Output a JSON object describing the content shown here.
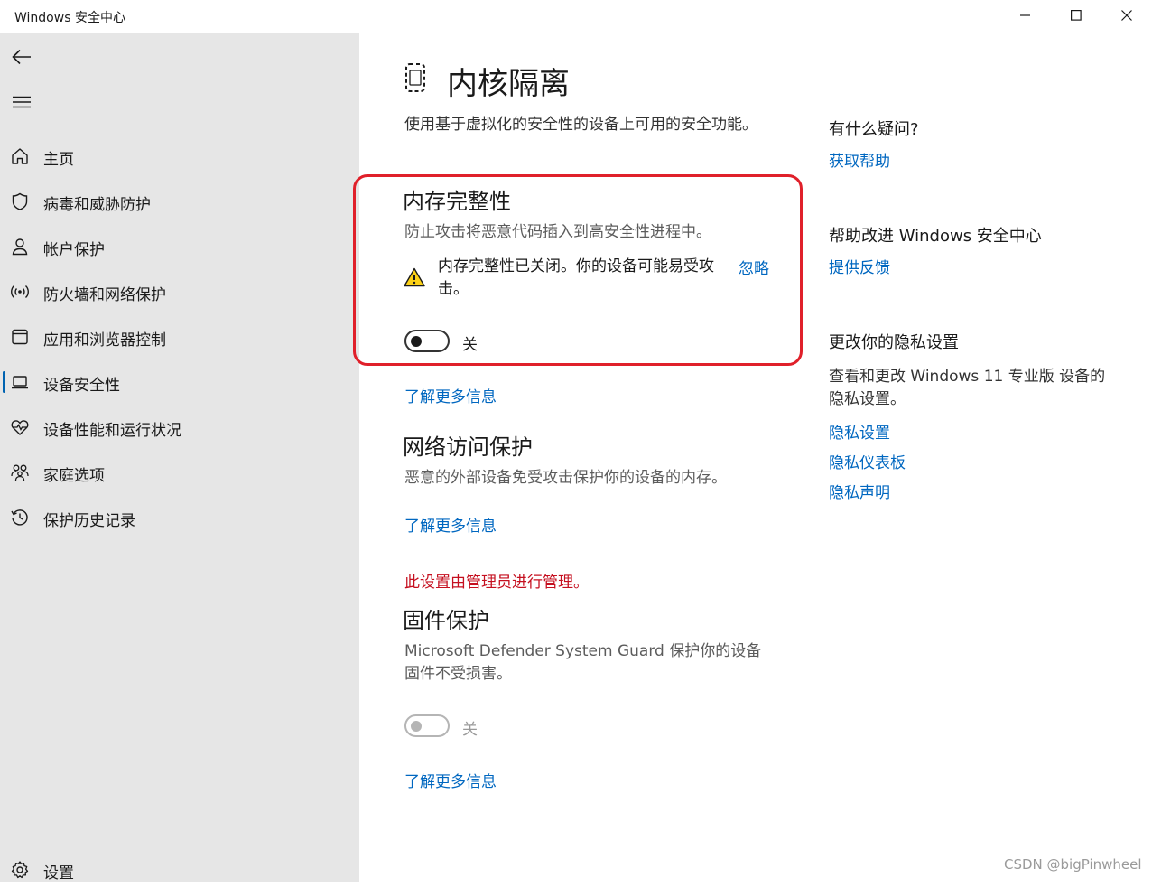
{
  "window": {
    "title": "Windows 安全中心"
  },
  "sidebar": {
    "items": [
      {
        "label": "主页",
        "icon": "home-icon"
      },
      {
        "label": "病毒和威胁防护",
        "icon": "shield-icon"
      },
      {
        "label": "帐户保护",
        "icon": "person-icon"
      },
      {
        "label": "防火墙和网络保护",
        "icon": "wifi-broadcast-icon"
      },
      {
        "label": "应用和浏览器控制",
        "icon": "app-window-icon"
      },
      {
        "label": "设备安全性",
        "icon": "laptop-icon",
        "active": true
      },
      {
        "label": "设备性能和运行状况",
        "icon": "heart-pulse-icon"
      },
      {
        "label": "家庭选项",
        "icon": "family-icon"
      },
      {
        "label": "保护历史记录",
        "icon": "history-icon"
      }
    ],
    "settings_label": "设置"
  },
  "main": {
    "title": "内核隔离",
    "description": "使用基于虚拟化的安全性的设备上可用的安全功能。",
    "memory_integrity": {
      "title": "内存完整性",
      "description": "防止攻击将恶意代码插入到高安全性进程中。",
      "warning": "内存完整性已关闭。你的设备可能易受攻击。",
      "dismiss_link": "忽略",
      "toggle_state": "关",
      "toggle_on": false
    },
    "learn_more_1": "了解更多信息",
    "network_access": {
      "title": "网络访问保护",
      "description": "恶意的外部设备免受攻击保护你的设备的内存。"
    },
    "learn_more_2": "了解更多信息",
    "admin_note": "此设置由管理员进行管理。",
    "firmware": {
      "title": "固件保护",
      "description": "Microsoft Defender System Guard 保护你的设备固件不受损害。",
      "toggle_state": "关",
      "toggle_on": false,
      "disabled": true
    },
    "learn_more_3": "了解更多信息"
  },
  "right_panel": {
    "question_title": "有什么疑问?",
    "get_help": "获取帮助",
    "improve_title": "帮助改进 Windows 安全中心",
    "feedback": "提供反馈",
    "privacy_title": "更改你的隐私设置",
    "privacy_desc": "查看和更改 Windows 11 专业版 设备的隐私设置。",
    "privacy_settings": "隐私设置",
    "privacy_dashboard": "隐私仪表板",
    "privacy_statement": "隐私声明"
  },
  "watermark": "CSDN @bigPinwheel",
  "colors": {
    "accent_link": "#0067c0",
    "active_bar": "#0063b1",
    "highlight_border": "#e0202a",
    "admin_note": "#c50f1f",
    "sidebar_bg": "#e6e6e6"
  }
}
